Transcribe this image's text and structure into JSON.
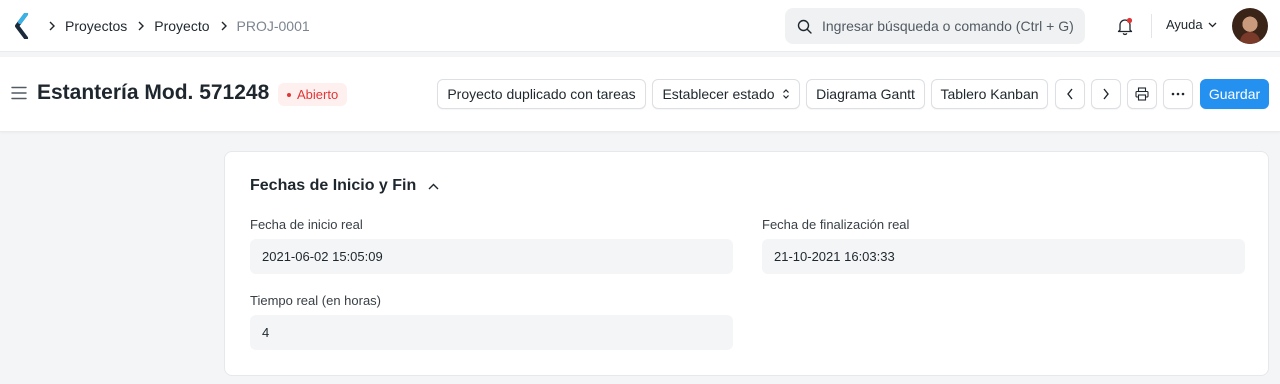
{
  "navbar": {
    "breadcrumbs": [
      "Proyectos",
      "Proyecto",
      "PROJ-0001"
    ],
    "search_placeholder": "Ingresar búsqueda o comando (Ctrl + G)",
    "help_label": "Ayuda"
  },
  "page": {
    "title": "Estantería Mod. 571248",
    "status": "Abierto",
    "actions": {
      "duplicate": "Proyecto duplicado con tareas",
      "set_status": "Establecer estado",
      "gantt": "Diagrama Gantt",
      "kanban": "Tablero Kanban",
      "save": "Guardar"
    }
  },
  "section": {
    "title": "Fechas de Inicio y Fin",
    "fields": {
      "actual_start_label": "Fecha de inicio real",
      "actual_start_value": "2021-06-02 15:05:09",
      "actual_end_label": "Fecha de finalización real",
      "actual_end_value": "21-10-2021 16:03:33",
      "actual_time_label": "Tiempo real (en horas)",
      "actual_time_value": "4"
    }
  },
  "colors": {
    "primary": "#2490ef",
    "status_red": "#e03636",
    "status_bg": "#fff0f0"
  }
}
